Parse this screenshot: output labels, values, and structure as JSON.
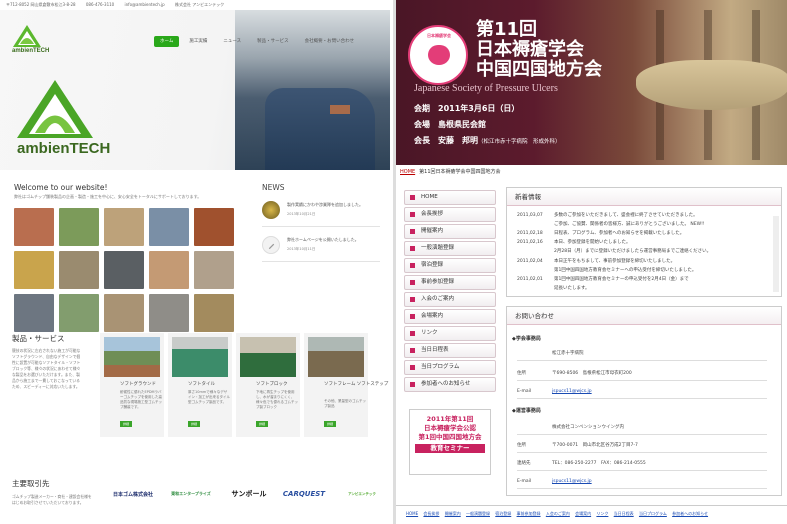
{
  "left": {
    "topbar": [
      "〒712-8052 岡山県倉敷市松江3-8-28",
      "086-476-3110",
      "info@ambientech.jp",
      "株式会社 アンビエンテック"
    ],
    "logo_text": "ambienTECH",
    "nav": [
      "ホーム",
      "施工実績",
      "ニュース",
      "製品・サービス",
      "会社概要・お問い合わせ"
    ],
    "big_logo_text": "ambienTECH",
    "welcome_title": "Welcome to our website!",
    "welcome_text": "弊社はゴムチップ舗装製品の企画・製造・施工を中心に、安心安全をトータルにサポートしております。",
    "news_title": "NEWS",
    "news": [
      {
        "text": "製作実績にかわや渉業隊を追加しました。",
        "date": "2013年10月21日"
      },
      {
        "text": "弊社ホームページを公開いたしました。",
        "date": "2013年10月11日"
      }
    ],
    "products_title": "製品・サービス",
    "products_desc": "競技の状況に左右されない施工が可能なソフトグラウンド、自由なデザインで個性に設置が可能なソフトタイル・ソフトブロック等、様々の状況にあわせて様々な製品をお選びいただけます。また、製品から施工まで一貫しておこなっているため、スピーディーに対応いたします。",
    "products": [
      {
        "name": "ソフトグラウンド",
        "desc": "耐候性に優れたEPDMラバーゴムチップを使用した高品質な現場施工型ゴムチップ舗装です。",
        "btn": "詳細"
      },
      {
        "name": "ソフトタイル",
        "desc": "厚さ10mmで様々なデザイン・加工が出来るタイル型ゴムチップ製品です。",
        "btn": "詳細"
      },
      {
        "name": "ソフトブロック",
        "desc": "下地に再生チップを使用し、水が溜まりにくく、様々色でも優れるゴムチップ製ブロック",
        "btn": "詳細"
      },
      {
        "name": "ソフトフレーム ソフトステップ",
        "desc": "その他、業量型のゴムチップ製品",
        "btn": "詳細"
      }
    ],
    "partners_title": "主要取引先",
    "partners_desc": "ゴムチップ製造メーカー・商社・建設会社様をはじめお取引させていただいております。",
    "partners": [
      "日本ゴム株式会社",
      "東和エンタープライズ",
      "サンポール",
      "CARQUEST",
      "アンビエンテック"
    ]
  },
  "right": {
    "badge_text": "日本褥瘡学会",
    "title_line1": "第11回",
    "title_line2": "日本褥瘡学会",
    "title_line3": "中国四国地方会",
    "subtitle": "Japanese Society of Pressure Ulcers",
    "info": [
      {
        "k": "会期",
        "v": "2011年3月6日（日）",
        "sm": ""
      },
      {
        "k": "会場",
        "v": "島根県民会館",
        "sm": ""
      },
      {
        "k": "会長",
        "v": "安藤　邦明",
        "sm": "（松江市赤十字病院　形成外科）"
      }
    ],
    "breadcrumb_home": "HOME",
    "breadcrumb_current": "第11回日本褥瘡学会中国四国地方会",
    "menu": [
      "HOME",
      "会長挨拶",
      "開催案内",
      "一般演題登録",
      "宿泊登録",
      "事前参加登録",
      "入会のご案内",
      "会場案内",
      "リンク",
      "当日日程表",
      "当日プログラム",
      "参加者へのお知らせ"
    ],
    "promo": [
      "2011年第11回",
      "日本褥瘡学会公認",
      "第1回中国四国地方会",
      "教育セミナー"
    ],
    "news_title": "新着情報",
    "news": [
      {
        "d": "2011,03,07",
        "t": "多数のご参加をいただきまして、盛会裡に終了させていただきました。"
      },
      {
        "d": "",
        "t": "ご参加、ご協賛、関係者の皆様方、誠にありがとうございました。 NEW!!"
      },
      {
        "d": "2011,02,18",
        "t": "日程表、プログラム、参加者へのお知らせを掲載いたしました。"
      },
      {
        "d": "2011,02,16",
        "t": "本日、参加登録を開始いたしました。"
      },
      {
        "d": "",
        "t": "2月28日（月）までに登録いただけましたら運営事務局までご連絡ください。"
      },
      {
        "d": "2011,02,04",
        "t": "本日正午をもちまして、事前参加登録を締切いたしました。"
      },
      {
        "d": "",
        "t": "第1回中国四国地方教育会セミナーへの申込受付を締切いたしました。"
      },
      {
        "d": "2011,02,01",
        "t": "第1回中国四国地方教育会セミナーの申込受付を2月4日（金）まで"
      },
      {
        "d": "",
        "t": "延長いたします。"
      }
    ],
    "contact_title": "お問い合わせ",
    "sec1": "◆学会事務局",
    "sec1_rows": [
      {
        "k": "",
        "v": "松江赤十字病院"
      },
      {
        "k": "住所",
        "v": "〒690-8506　島根県松江市母衣町200"
      },
      {
        "k": "E-mail",
        "v": "jspucs11@wjcs.jp"
      }
    ],
    "sec2": "◆運営事務局",
    "sec2_rows": [
      {
        "k": "",
        "v": "株式会社コンベンションウイング内"
      },
      {
        "k": "住所",
        "v": "〒700-0071　岡山市北区谷万成2丁目7-7"
      },
      {
        "k": "連絡先",
        "v": "TEL：086-250-2277　FAX：086-214-0555"
      },
      {
        "k": "E-mail",
        "v": "jspucs11@wjcs.jp"
      }
    ],
    "footer": [
      "HOME",
      "会長挨拶",
      "開催案内",
      "一般演題登録",
      "宿泊登録",
      "事前参加登録",
      "入会のご案内",
      "会場案内",
      "リンク",
      "当日日程表",
      "当日プログラム",
      "参加者へのお知らせ"
    ]
  },
  "colors": {
    "brand_green": "#2aa81a",
    "brand_pink": "#c8225f",
    "banner": "#5c1b2d"
  }
}
